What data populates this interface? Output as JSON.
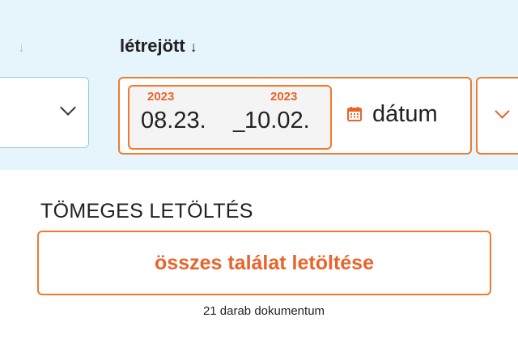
{
  "filters": {
    "created_column": {
      "header": "létrejött",
      "sort_indicator": "↓"
    },
    "left_column": {
      "sort_indicator": "↓"
    },
    "date_range": {
      "start_year": "2023",
      "start_date": "08.23.",
      "separator": "_",
      "end_year": "2023",
      "end_date": "10.02.",
      "type_label": "dátum"
    }
  },
  "bulk_download": {
    "title": "TÖMEGES LETÖLTÉS",
    "button_label": "összes találat letöltése",
    "count_text": "21 darab dokumentum"
  },
  "colors": {
    "accent": "#f07a2e",
    "accent_text": "#e8642a",
    "filter_band": "#e6f4fc",
    "input_border_blue": "#8ecbe8"
  },
  "icons": [
    "calendar-icon",
    "chevron-down-icon",
    "sort-down-icon"
  ]
}
